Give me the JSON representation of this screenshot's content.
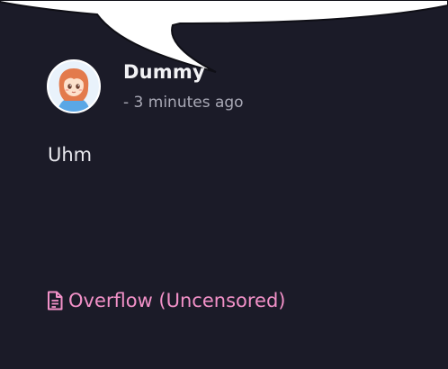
{
  "post": {
    "username": "Dummy",
    "timestamp": "- 3 minutes ago",
    "message": "Uhm",
    "avatar_icon": "anime-girl-avatar-icon"
  },
  "tag": {
    "icon": "document-icon",
    "label": "Overflow (Uncensored)",
    "color": "#f291c8"
  },
  "colors": {
    "background": "#1b1b28",
    "bubble": "#ffffff"
  }
}
